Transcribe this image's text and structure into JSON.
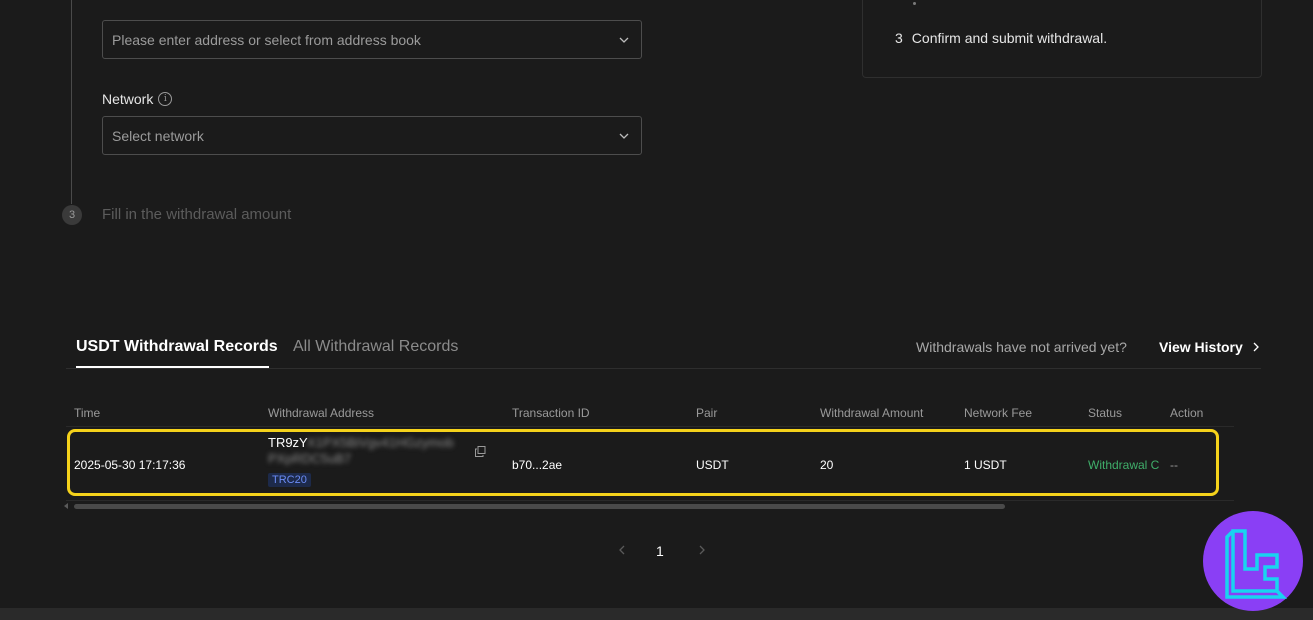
{
  "form": {
    "address_placeholder": "Please enter address or select from address book",
    "network_label": "Network",
    "network_placeholder": "Select network",
    "step3_number": "3",
    "step3_label": "Fill in the withdrawal amount"
  },
  "info_panel": {
    "step_number": "3",
    "step_text": "Confirm and submit withdrawal."
  },
  "records": {
    "tab_active": "USDT Withdrawal Records",
    "tab_inactive": "All Withdrawal Records",
    "not_arrived": "Withdrawals have not arrived yet?",
    "view_history": "View History",
    "columns": [
      "Time",
      "Withdrawal Address",
      "Transaction ID",
      "Pair",
      "Withdrawal Amount",
      "Network Fee",
      "Status",
      "Action"
    ],
    "row": {
      "time": "2025-05-30 17:17:36",
      "address_visible": "TR9zY",
      "address_blur_1": "X1PX5BiVgv41HGzymob",
      "address_blur_2": "PXpRDC5uB7",
      "network": "TRC20",
      "tx_id": "b70...2ae",
      "pair": "USDT",
      "amount": "20",
      "fee": "1 USDT",
      "status": "Withdrawal Completed",
      "action": "--"
    }
  },
  "pagination": {
    "current": "1"
  },
  "colors": {
    "highlight": "#f5d21b",
    "status_green": "#3fae6a",
    "tag_blue": "#6b8cf5",
    "logo_purple": "#8a3ff5",
    "logo_cyan": "#19d3f0"
  }
}
